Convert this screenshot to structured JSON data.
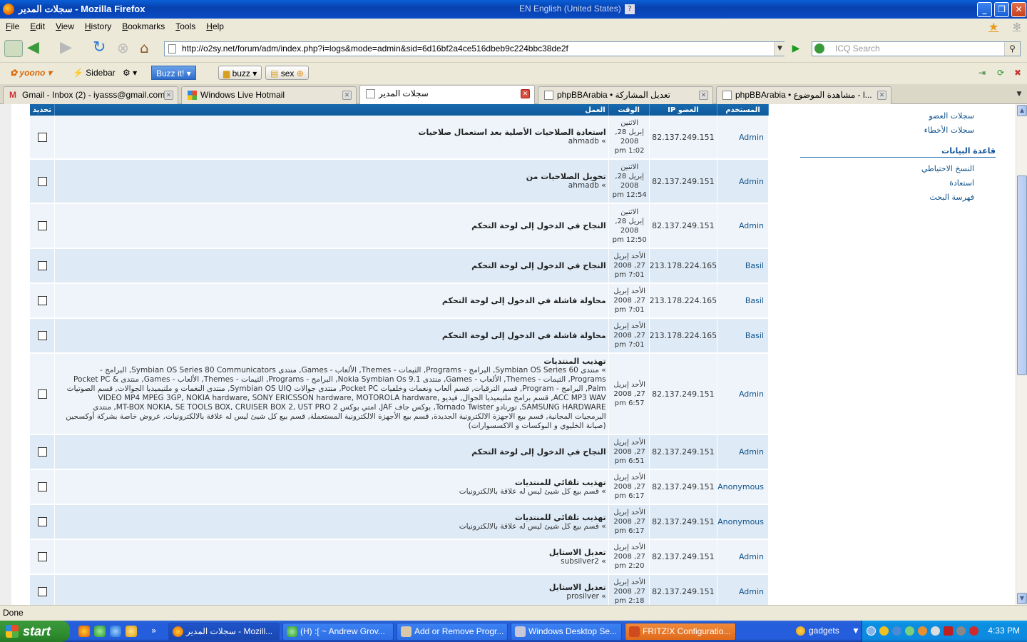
{
  "window": {
    "title": "سجلات المدير - Mozilla Firefox",
    "language": "EN English (United States)",
    "help": "?"
  },
  "menu": [
    "File",
    "Edit",
    "View",
    "History",
    "Bookmarks",
    "Tools",
    "Help"
  ],
  "navbar": {
    "url": "http://o2sy.net/forum/adm/index.php?i=logs&mode=admin&sid=6d16bf2a4ce516dbeb9c224bbc38de2f",
    "search_placeholder": "ICQ Search"
  },
  "bookmarks": {
    "yoono": "yoono",
    "sidebar": "Sidebar",
    "buzz_it": "Buzz it!",
    "buzz": "buzz",
    "sex": "sex"
  },
  "tabs": [
    {
      "label": "Gmail - Inbox (2) - iyasss@gmail.com",
      "icon": "gmail-icon"
    },
    {
      "label": "Windows Live Hotmail",
      "icon": "windows-icon"
    },
    {
      "label": "سجلات المدير",
      "icon": "page-icon",
      "active": true
    },
    {
      "label": "phpBBArabia • تعديل المشاركة",
      "icon": "page-icon"
    },
    {
      "label": "phpBBArabia • مشاهدة الموضوع - l...",
      "icon": "page-icon"
    }
  ],
  "table": {
    "headers": {
      "user": "المستخدم",
      "ip": "IP العضو",
      "time": "الوقت",
      "action": "العمل",
      "select": "تحديد"
    },
    "rows": [
      {
        "user": "Admin",
        "ip": "82.137.249.151",
        "time": [
          "الاثنين",
          "إبريل 28,",
          "2008",
          "1:02 pm"
        ],
        "action": "استعادة الصلاحيات الأصلية بعد استعمال صلاحيات",
        "detail": "» ahmadb"
      },
      {
        "user": "Admin",
        "ip": "82.137.249.151",
        "time": [
          "الاثنين",
          "إبريل 28,",
          "2008",
          "12:54 pm"
        ],
        "action": "تحويل الصلاحيات من",
        "detail": "» ahmadb"
      },
      {
        "user": "Admin",
        "ip": "82.137.249.151",
        "time": [
          "الاثنين",
          "إبريل 28,",
          "2008",
          "12:50 pm"
        ],
        "action": "النجاح في الدخول إلى لوحة التحكم",
        "detail": ""
      },
      {
        "user": "Basil",
        "ip": "213.178.224.165",
        "time": [
          "الأحد إبريل",
          "27, 2008",
          "7:01 pm"
        ],
        "action": "النجاح في الدخول إلى لوحة التحكم",
        "detail": ""
      },
      {
        "user": "Basil",
        "ip": "213.178.224.165",
        "time": [
          "الأحد إبريل",
          "27, 2008",
          "7:01 pm"
        ],
        "action": "محاولة فاشلة في الدخول إلى لوحة التحكم",
        "detail": ""
      },
      {
        "user": "Basil",
        "ip": "213.178.224.165",
        "time": [
          "الأحد إبريل",
          "27, 2008",
          "7:01 pm"
        ],
        "action": "محاولة فاشلة في الدخول إلى لوحة التحكم",
        "detail": ""
      },
      {
        "user": "Admin",
        "ip": "82.137.249.151",
        "time": [
          "الأحد إبريل",
          "27, 2008",
          "6:57 pm"
        ],
        "action": "تهذيب المنتديات",
        "detail": "» منتدى Symbian OS Series 60, البرامج - Programs, الثيمات - Themes, الألعاب - Games, منتدى Symbian OS Series 80 Communicators, البرامج - Programs, الثيمات - Themes, الألعاب - Games, منتدى Nokia Symbian Os 9.1, البرامج - Programs, الثيمات - Themes, الألعاب - Games, منتدى Pocket PC & Palm, البرامج - Program, قسم الترقيات, قسم ألعاب ونغمات وخلفيات Pocket PC, منتدى جوالات Symbian OS UIQ, منتدى النغمات و ملتيميديا الجوالات, قسم الصوتيات ACC MP3 WAV, قسم برامج ملتيميديا الجوال, فيديو VIDEO MP4 MPEG 3GP, NOKIA hardware, SONY ERICSSON hardware, MOTOROLA hardware, SAMSUNG HARDWARE, تورنادو Tornado Twister, بوكس جاف JAF, امتي بوكس MT-BOX NOKIA, SE TOOLS BOX, CRUISER BOX 2, UST PRO 2, منتدى البرمجيات المجانية, قسم بيع الاجهزة الالكترونية الجديدة, قسم بيع الأجهزة الالكترونية المستعملة, قسم بيع كل شيئ ليس له علاقة بالالكترونيات, عروض خاصة بشركة أوكسجين (صيانة الخليوي و البوكسات و الاكسسوارات)"
      },
      {
        "user": "Admin",
        "ip": "82.137.249.151",
        "time": [
          "الأحد إبريل",
          "27, 2008",
          "6:51 pm"
        ],
        "action": "النجاح في الدخول إلى لوحة التحكم",
        "detail": ""
      },
      {
        "user": "Anonymous",
        "ip": "82.137.249.151",
        "time": [
          "الأحد إبريل",
          "27, 2008",
          "6:17 pm"
        ],
        "action": "تهذيب تلقائي للمنتديات",
        "detail": "» قسم بيع كل شيئ ليس له علاقة بالالكترونيات"
      },
      {
        "user": "Anonymous",
        "ip": "82.137.249.151",
        "time": [
          "الأحد إبريل",
          "27, 2008",
          "6:17 pm"
        ],
        "action": "تهذيب تلقائي للمنتديات",
        "detail": "» قسم بيع كل شيئ ليس له علاقة بالالكترونيات"
      },
      {
        "user": "Admin",
        "ip": "82.137.249.151",
        "time": [
          "الأحد إبريل",
          "27, 2008",
          "2:20 pm"
        ],
        "action": "تعديل الاستايل",
        "detail": "» subsilver2"
      },
      {
        "user": "Admin",
        "ip": "82.137.249.151",
        "time": [
          "الأحد إبريل",
          "27, 2008",
          "2:18 pm"
        ],
        "action": "تعديل الاستايل",
        "detail": "» prosilver"
      }
    ]
  },
  "right_menu": {
    "items_top": [
      "سجلات العضو",
      "سجلات الأخطاء"
    ],
    "section_head": "قاعدة البيانات",
    "items_db": [
      "النسخ الاحتياطي",
      "استعادة",
      "فهرسة البحث"
    ]
  },
  "status": "Done",
  "taskbar": {
    "start": "start",
    "tasks": [
      {
        "label": "سجلات المدير - Mozill...",
        "active": true,
        "color": "#1e53c8"
      },
      {
        "label": "(H) :[ ~ Andrew Grov...",
        "color": "#3c81f3"
      },
      {
        "label": "Add or Remove Progr...",
        "color": "#3c81f3"
      },
      {
        "label": "Windows Desktop Se...",
        "color": "#3c81f3"
      },
      {
        "label": "FRITZ!X Configuratio...",
        "color": "#f08a3a"
      }
    ],
    "gadgets": "gadgets",
    "clock": "4:33 PM"
  }
}
